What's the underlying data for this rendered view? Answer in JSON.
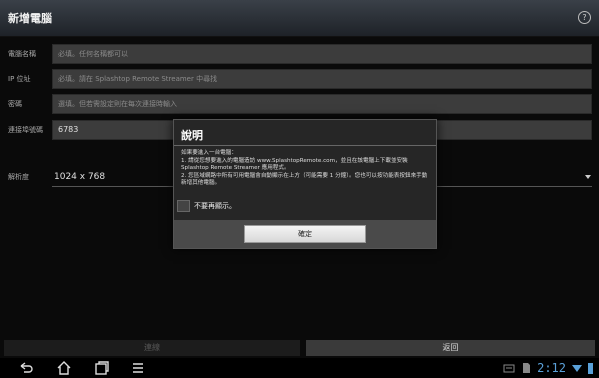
{
  "titlebar": {
    "title": "新增電腦"
  },
  "form": {
    "fields": [
      {
        "label": "電腦名稱",
        "placeholder": "必填。任何名稱都可以",
        "value": ""
      },
      {
        "label": "IP 位址",
        "placeholder": "必填。請在 Splashtop Remote Streamer 中尋找",
        "value": ""
      },
      {
        "label": "密碼",
        "placeholder": "選填。但若需設定則在每次連接時輸入",
        "value": ""
      },
      {
        "label": "連接埠號碼",
        "placeholder": "",
        "value": "6783"
      }
    ],
    "resolution": {
      "label": "解析度",
      "value": "1024 x 768"
    }
  },
  "dialog": {
    "title": "說明",
    "body_line1": "如果要進入一台電腦：",
    "body_line2": "1. 請從您想要進入的電腦造訪 www.SplashtopRemote.com，並且在該電腦上下載並安裝 Splashtop Remote Streamer 應用程式。",
    "body_line3": "2. 您區域網路中所有可用電腦會自動顯示在上方（可能需要 1 分鐘）。您也可以按功能表按鈕來手動新增其他電腦。",
    "checkbox_label": "不要再顯示。",
    "ok_label": "確定"
  },
  "actions": {
    "connect_label": "連線",
    "back_label": "返回"
  },
  "statusbar": {
    "time": "2:12"
  }
}
